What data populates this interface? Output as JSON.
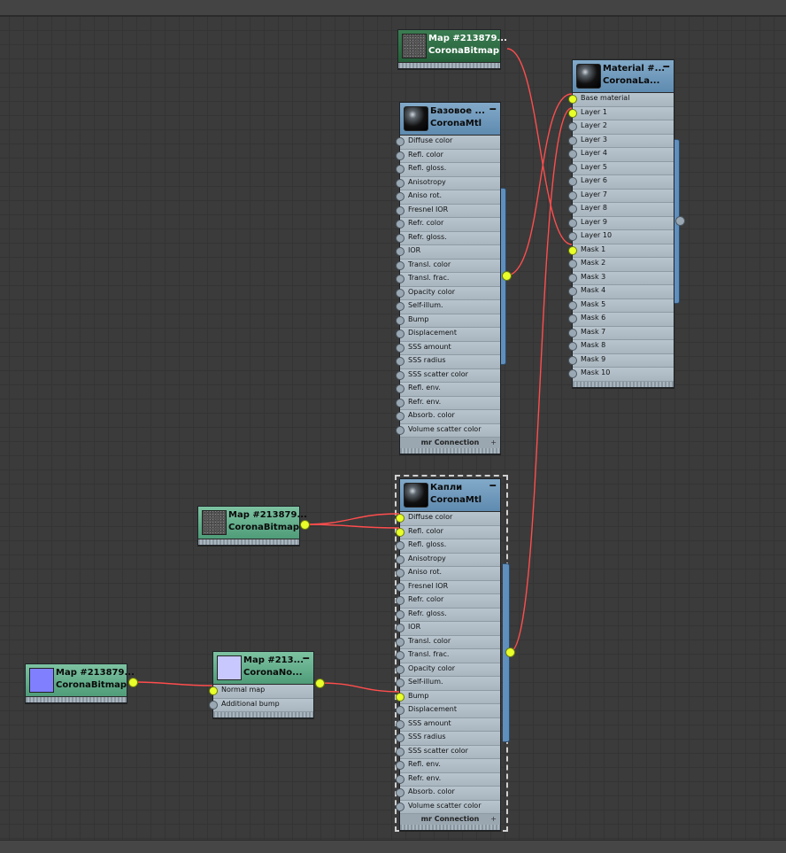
{
  "nodes": {
    "map_top": {
      "title": "Map #213879...",
      "subtitle": "CoronaBitmap",
      "thumbnail": "noise-texture"
    },
    "layered": {
      "title": "Material #...",
      "subtitle": "CoronaLa...",
      "thumbnail": "black-sphere",
      "slots": [
        "Base material",
        "Layer 1",
        "Layer 2",
        "Layer 3",
        "Layer 4",
        "Layer 5",
        "Layer 6",
        "Layer 7",
        "Layer 8",
        "Layer 9",
        "Layer 10",
        "Mask 1",
        "Mask 2",
        "Mask 3",
        "Mask 4",
        "Mask 5",
        "Mask 6",
        "Mask 7",
        "Mask 8",
        "Mask 9",
        "Mask 10"
      ]
    },
    "base_mtl": {
      "title": "Базовое ...",
      "subtitle": "CoronaMtl",
      "thumbnail": "black-sphere",
      "slots": [
        "Diffuse color",
        "Refl. color",
        "Refl. gloss.",
        "Anisotropy",
        "Aniso rot.",
        "Fresnel IOR",
        "Refr. color",
        "Refr. gloss.",
        "IOR",
        "Transl. color",
        "Transl. frac.",
        "Opacity color",
        "Self-illum.",
        "Bump",
        "Displacement",
        "SSS amount",
        "SSS radius",
        "SSS scatter color",
        "Refl. env.",
        "Refr. env.",
        "Absorb. color",
        "Volume scatter color"
      ],
      "footer": "mr Connection"
    },
    "kapli_mtl": {
      "title": "Капли",
      "subtitle": "CoronaMtl",
      "thumbnail": "black-sphere",
      "slots": [
        "Diffuse color",
        "Refl. color",
        "Refl. gloss.",
        "Anisotropy",
        "Aniso rot.",
        "Fresnel IOR",
        "Refr. color",
        "Refr. gloss.",
        "IOR",
        "Transl. color",
        "Transl. frac.",
        "Opacity color",
        "Self-illum.",
        "Bump",
        "Displacement",
        "SSS amount",
        "SSS radius",
        "SSS scatter color",
        "Refl. env.",
        "Refr. env.",
        "Absorb. color",
        "Volume scatter color"
      ],
      "footer": "mr Connection"
    },
    "map_mid": {
      "title": "Map #213879...",
      "subtitle": "CoronaBitmap",
      "thumbnail": "noise-texture"
    },
    "map_bottom": {
      "title": "Map #213879...",
      "subtitle": "CoronaBitmap",
      "thumbnail": "violet-swatch"
    },
    "normal_map": {
      "title": "Map #213...",
      "subtitle": "CoronaNo...",
      "thumbnail": "lavender-swatch",
      "slots": [
        "Normal map",
        "Additional bump"
      ]
    }
  },
  "colors": {
    "canvas": "#3b3b3b",
    "wire": "#ff4d4d",
    "socket_active": "#e8ff2a",
    "material_header": "#6f97ba",
    "map_header": "#5fae88",
    "selected_map_header": "#2f6e46"
  }
}
